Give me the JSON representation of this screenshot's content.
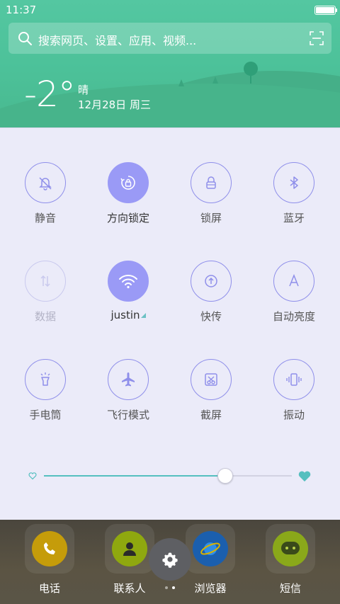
{
  "status_bar": {
    "time": "11:37"
  },
  "search": {
    "placeholder": "搜索网页、设置、应用、视频..."
  },
  "weather": {
    "temperature": "-2°",
    "condition": "晴",
    "date": "12月28日 周三"
  },
  "quick_settings": {
    "tiles": [
      {
        "label": "静音",
        "icon": "silent-bell-icon",
        "state": "off"
      },
      {
        "label": "方向锁定",
        "icon": "rotation-lock-icon",
        "state": "on"
      },
      {
        "label": "锁屏",
        "icon": "lock-icon",
        "state": "off"
      },
      {
        "label": "蓝牙",
        "icon": "bluetooth-icon",
        "state": "off"
      },
      {
        "label": "数据",
        "icon": "mobile-data-icon",
        "state": "disabled"
      },
      {
        "label": "justin",
        "icon": "wifi-icon",
        "state": "on"
      },
      {
        "label": "快传",
        "icon": "quick-transfer-icon",
        "state": "off"
      },
      {
        "label": "自动亮度",
        "icon": "auto-brightness-icon",
        "state": "off"
      },
      {
        "label": "手电筒",
        "icon": "flashlight-icon",
        "state": "off"
      },
      {
        "label": "飞行模式",
        "icon": "airplane-icon",
        "state": "off"
      },
      {
        "label": "截屏",
        "icon": "screenshot-icon",
        "state": "off"
      },
      {
        "label": "振动",
        "icon": "vibrate-icon",
        "state": "off"
      }
    ],
    "brightness_level": 0.73
  },
  "dock": {
    "apps": [
      {
        "label": "电话",
        "icon": "phone-icon",
        "color": "#f2c200"
      },
      {
        "label": "联系人",
        "icon": "contacts-icon",
        "color": "#b6d000"
      },
      {
        "label": "浏览器",
        "icon": "browser-icon",
        "color": "#1a7fe0"
      },
      {
        "label": "短信",
        "icon": "messages-icon",
        "color": "#1ec6c0"
      }
    ]
  },
  "colors": {
    "accent": "#9a9af6",
    "header_green": "#4cc199",
    "slider": "#55bfbf"
  }
}
